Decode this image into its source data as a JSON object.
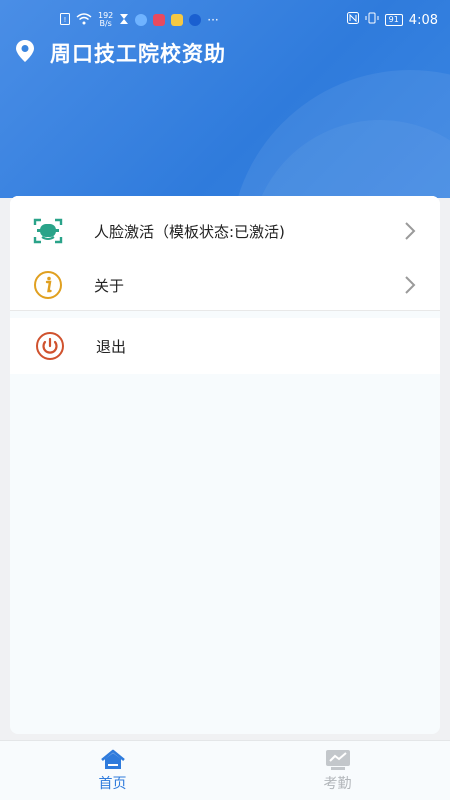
{
  "status_bar": {
    "net_speed_top": "192",
    "net_speed_bottom": "B/s",
    "battery": "91",
    "time": "4:08",
    "more": "···"
  },
  "header": {
    "title": "周口技工院校资助",
    "icon": "location-pin-icon"
  },
  "menu": {
    "items": [
      {
        "label": "人脸激活（模板状态:已激活)",
        "icon": "face-scan-icon",
        "color": "#2aa389"
      },
      {
        "label": "关于",
        "icon": "info-icon",
        "color": "#e0a020"
      }
    ],
    "logout": {
      "label": "退出",
      "icon": "power-icon",
      "color": "#d0522e"
    }
  },
  "tabbar": {
    "tabs": [
      {
        "label": "首页",
        "icon": "home-icon",
        "active": true,
        "color": "#2f7bdc"
      },
      {
        "label": "考勤",
        "icon": "chart-icon",
        "active": false,
        "color": "#b8bcc0"
      }
    ]
  }
}
